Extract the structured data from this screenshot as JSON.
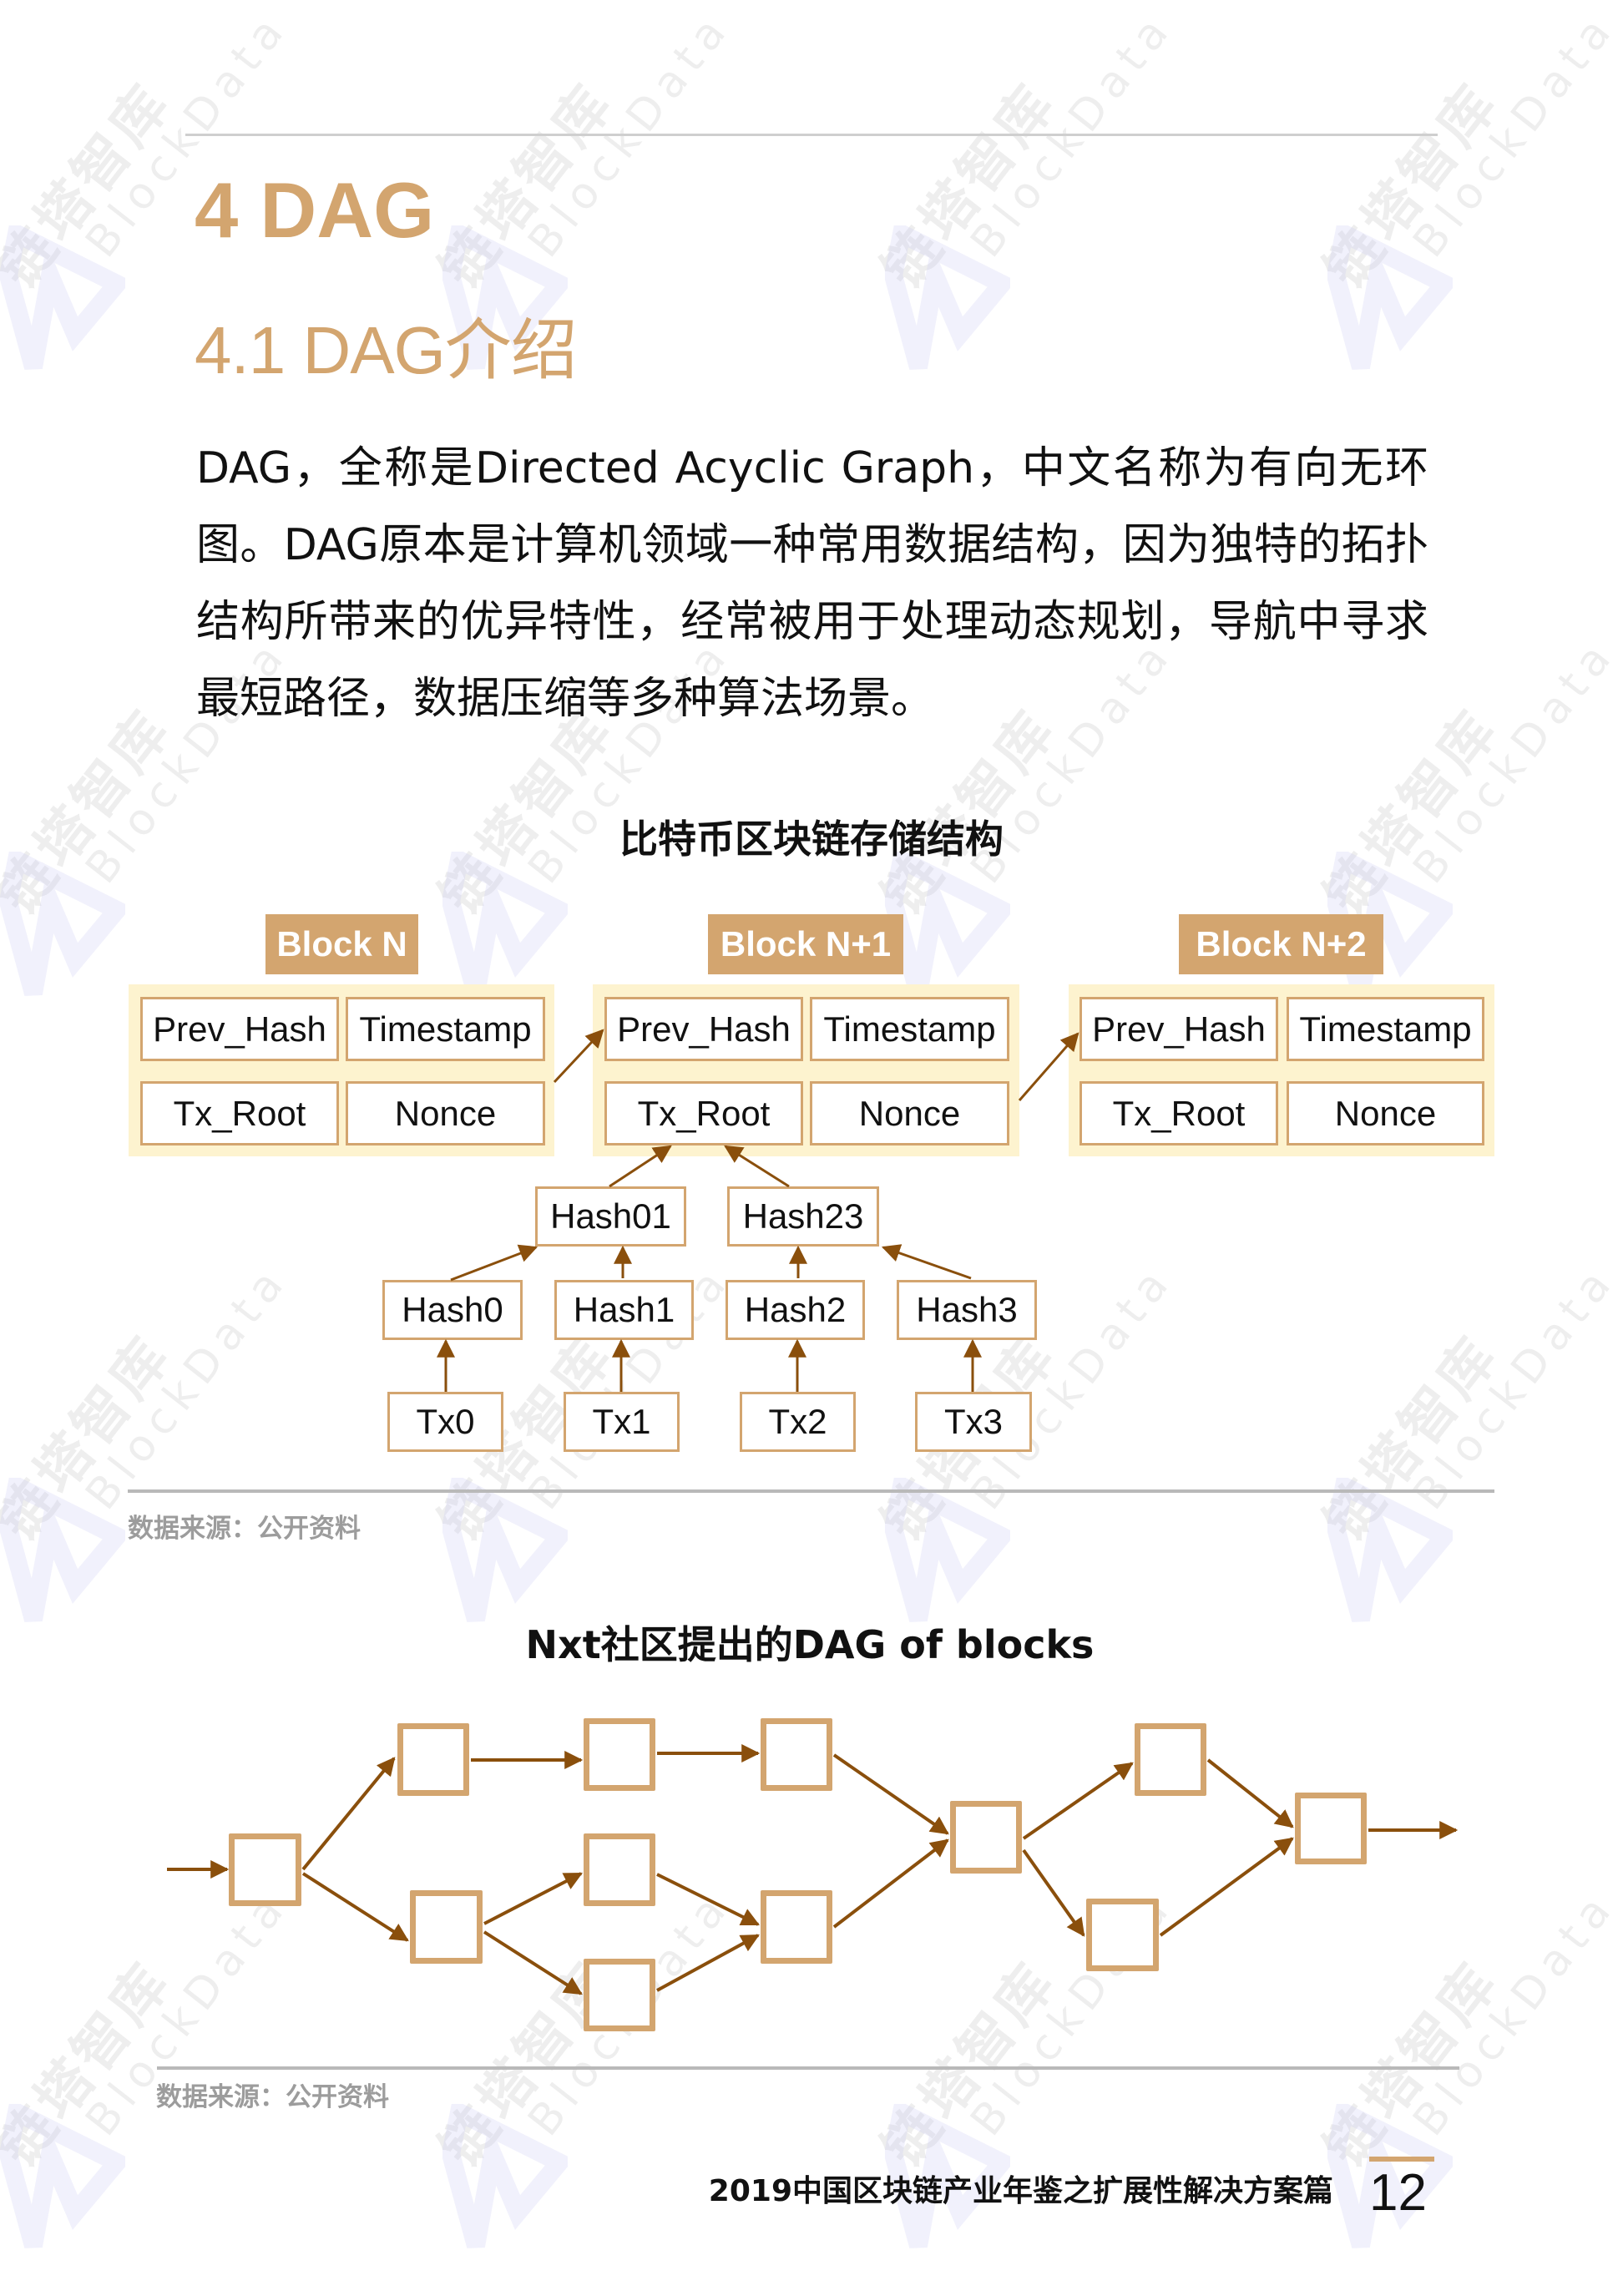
{
  "watermark": {
    "cn": "链塔智库",
    "en": "BlockData"
  },
  "heading": {
    "chapter": "4 DAG",
    "section": "4.1 DAG介绍"
  },
  "body": {
    "paragraph": "DAG，全称是Directed Acyclic Graph，中文名称为有向无环图。DAG原本是计算机领域一种常用数据结构，因为独特的拓扑结构所带来的优异特性，经常被用于处理动态规划，导航中寻求最短路径，数据压缩等多种算法场景。"
  },
  "figure1": {
    "title": "比特币区块链存储结构",
    "blocks": [
      {
        "label": "Block N",
        "fields": [
          "Prev_Hash",
          "Timestamp",
          "Tx_Root",
          "Nonce"
        ]
      },
      {
        "label": "Block N+1",
        "fields": [
          "Prev_Hash",
          "Timestamp",
          "Tx_Root",
          "Nonce"
        ]
      },
      {
        "label": "Block N+2",
        "fields": [
          "Prev_Hash",
          "Timestamp",
          "Tx_Root",
          "Nonce"
        ]
      }
    ],
    "merkle": {
      "level1": [
        "Hash01",
        "Hash23"
      ],
      "level2": [
        "Hash0",
        "Hash1",
        "Hash2",
        "Hash3"
      ],
      "leaves": [
        "Tx0",
        "Tx1",
        "Tx2",
        "Tx3"
      ]
    },
    "source": "数据来源：公开资料"
  },
  "figure2": {
    "title": "Nxt社区提出的DAG of blocks",
    "block_count": 12,
    "source": "数据来源：公开资料"
  },
  "footer": {
    "report_title": "2019中国区块链产业年鉴之扩展性解决方案篇",
    "page_number": "12"
  },
  "colors": {
    "accent": "#d3a56f",
    "block_bg": "#fdf3cf",
    "arrow": "#8a4f0c",
    "caption": "#9c9c9c"
  }
}
